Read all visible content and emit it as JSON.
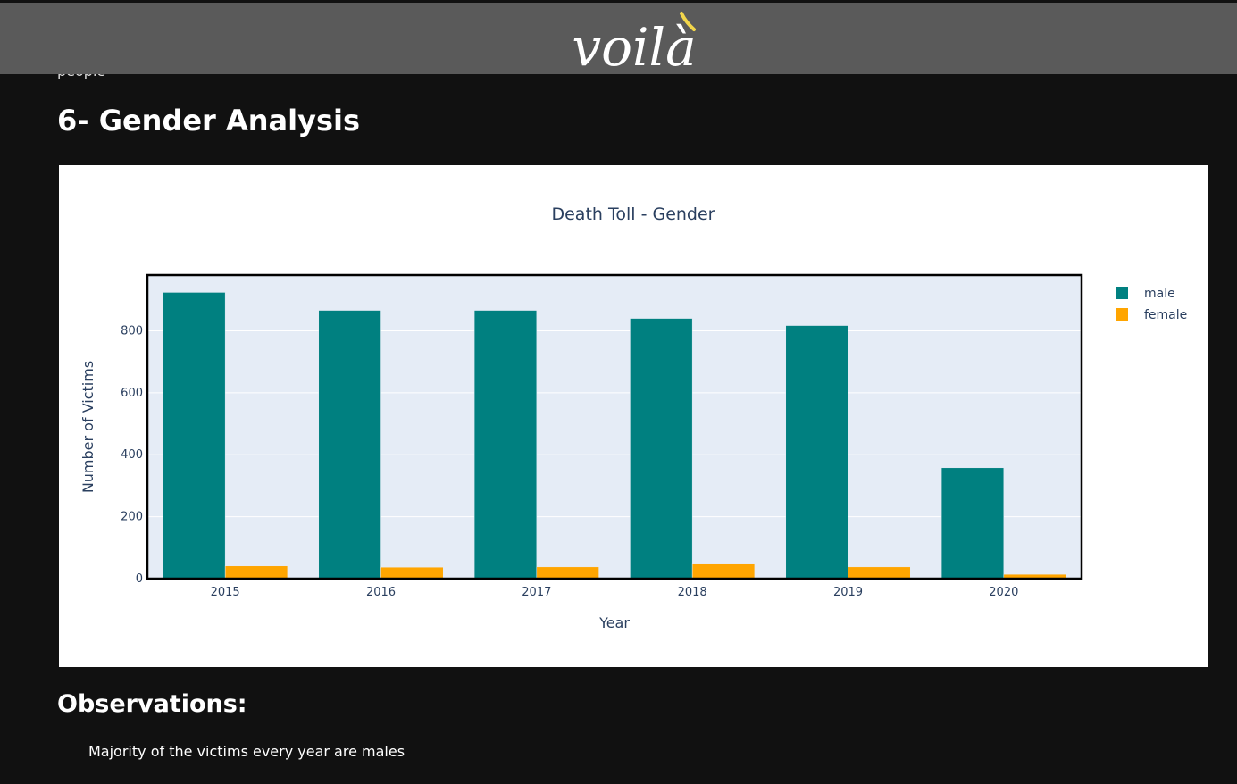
{
  "header": {
    "logo_text": "voilà",
    "logo_accent_color": "#f2d64b"
  },
  "page": {
    "cut_off_text": "people",
    "section_title": "6- Gender Analysis",
    "observations_title": "Observations:",
    "observation_text": "Majority of the victims every year are males"
  },
  "chart_data": {
    "type": "bar",
    "title": "Death Toll - Gender",
    "xlabel": "Year",
    "ylabel": "Number of Victims",
    "categories": [
      "2015",
      "2016",
      "2017",
      "2018",
      "2019",
      "2020"
    ],
    "series": [
      {
        "name": "male",
        "color": "#008080",
        "values": [
          924,
          866,
          866,
          840,
          817,
          358
        ]
      },
      {
        "name": "female",
        "color": "#ffa500",
        "values": [
          41,
          37,
          38,
          47,
          38,
          14
        ]
      }
    ],
    "ylim": [
      0,
      980
    ],
    "yticks": [
      0,
      200,
      400,
      600,
      800
    ],
    "grid": true,
    "legend": "top-right"
  }
}
